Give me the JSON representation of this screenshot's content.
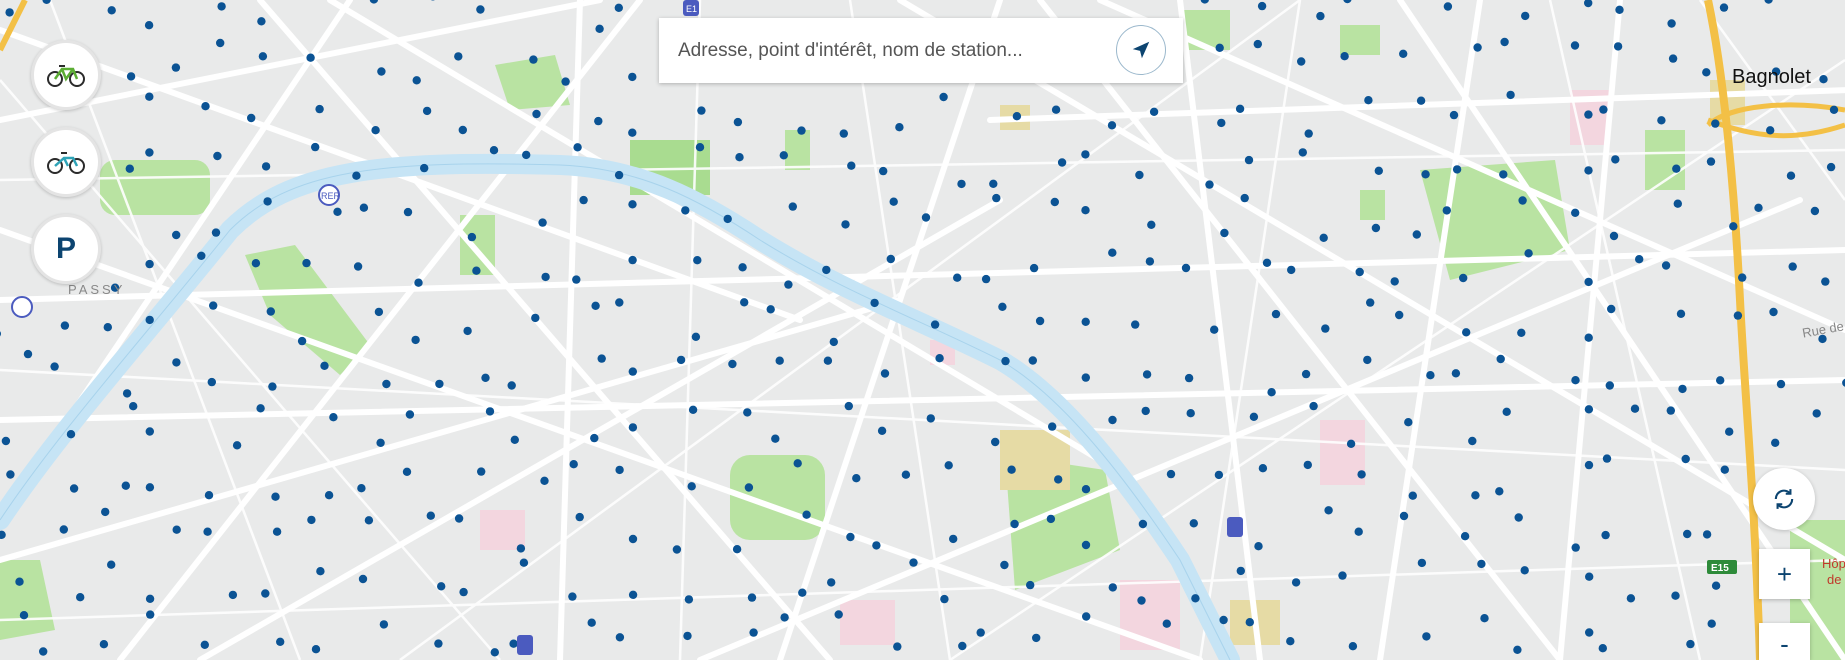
{
  "search": {
    "placeholder": "Adresse, point d'intérêt, nom de station..."
  },
  "buttons": {
    "mechanical_bike": "mechanical-bike-icon",
    "electric_bike": "electric-bike-icon",
    "parking_label": "P",
    "locate": "navigation-arrow-icon",
    "refresh": "refresh-icon",
    "zoom_in": "+",
    "zoom_out": "-"
  },
  "map": {
    "labels": {
      "bagnolet": "Bagnolet",
      "passy": "PASSY",
      "rue": "Rue de",
      "hopital": "Hôp",
      "hopital2": "de",
      "highway": "E15",
      "rer": "RER",
      "metro_top": "E1"
    },
    "colors": {
      "base": "#e9eaea",
      "river": "#c6e4f5",
      "park": "#b9e3a2",
      "station": "#0b5394",
      "highway": "#f3c046",
      "road": "#ffffff"
    }
  }
}
